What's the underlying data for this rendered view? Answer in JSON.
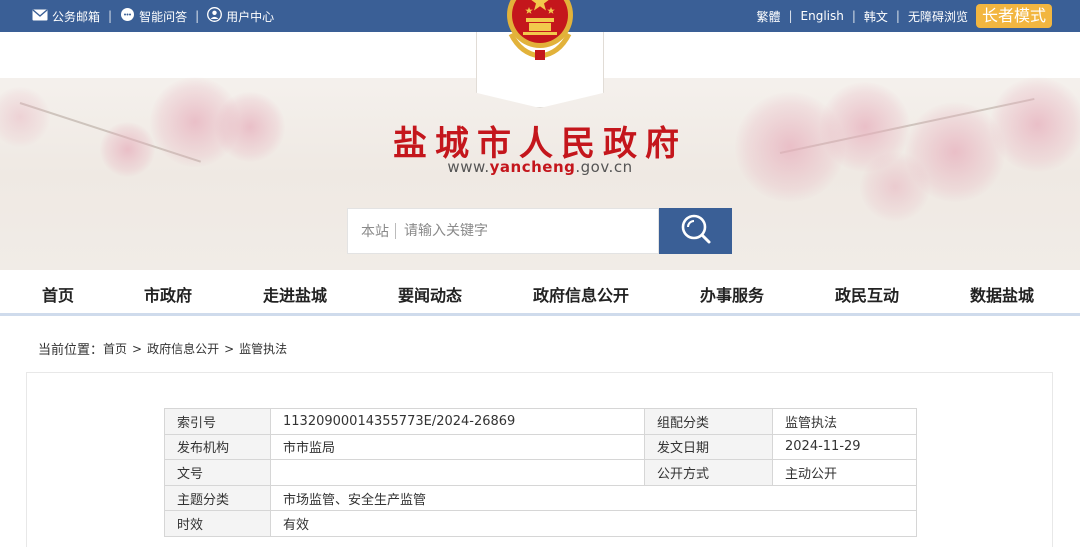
{
  "topbar": {
    "mail": "公务邮箱",
    "qa": "智能问答",
    "user_center": "用户中心",
    "traditional": "繁體",
    "english": "English",
    "korean": "韩文",
    "accessible": "无障碍浏览",
    "elder_mode": "长者模式"
  },
  "header": {
    "site_title": "盐城市人民政府",
    "url_prefix": "www.",
    "url_domain": "yancheng",
    "url_suffix": ".gov.cn"
  },
  "search": {
    "scope": "本站",
    "placeholder": "请输入关键字"
  },
  "nav": {
    "items": [
      "首页",
      "市政府",
      "走进盐城",
      "要闻动态",
      "政府信息公开",
      "办事服务",
      "政民互动",
      "数据盐城"
    ]
  },
  "breadcrumb": {
    "label": "当前位置：",
    "home": "首页",
    "level1": "政府信息公开",
    "level2": "监管执法",
    "separator": ">"
  },
  "meta_table": {
    "index_label": "索引号",
    "index_value": "11320900014355773E/2024-26869",
    "category_label": "组配分类",
    "category_value": "监管执法",
    "publisher_label": "发布机构",
    "publisher_value": "市市监局",
    "date_label": "发文日期",
    "date_value": "2024-11-29",
    "docno_label": "文号",
    "docno_value": "",
    "disclosure_label": "公开方式",
    "disclosure_value": "主动公开",
    "topic_label": "主题分类",
    "topic_value": "市场监管、安全生产监管",
    "validity_label": "时效",
    "validity_value": "有效"
  },
  "colors": {
    "topbar": "#3a5f96",
    "title_red": "#c4161c",
    "elder_button": "#f2b640",
    "nav_underline": "#cfdbec"
  },
  "icons": [
    "mail-icon",
    "chat-icon",
    "user-icon",
    "national-emblem",
    "search-icon"
  ]
}
